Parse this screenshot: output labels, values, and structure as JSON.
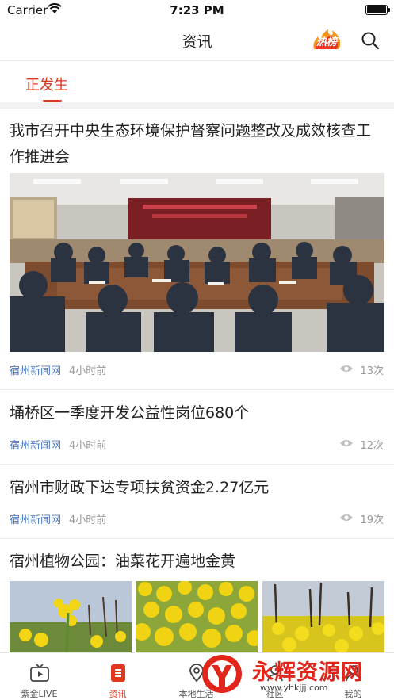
{
  "status_bar": {
    "carrier": "Carrier",
    "time": "7:23 PM"
  },
  "nav": {
    "title": "资讯",
    "hot_badge": "热榜",
    "search_icon": "search-icon"
  },
  "tabs": [
    {
      "label": "正发生",
      "active": true
    }
  ],
  "news": [
    {
      "title": "我市召开中央生态环境保护督察问题整改及成效核查工作推进会",
      "source": "宿州新闻网",
      "time": "4小时前",
      "views": "13次",
      "image": "meeting-photo"
    },
    {
      "title": "埇桥区一季度开发公益性岗位680个",
      "source": "宿州新闻网",
      "time": "4小时前",
      "views": "12次"
    },
    {
      "title": "宿州市财政下达专项扶贫资金2.27亿元",
      "source": "宿州新闻网",
      "time": "4小时前",
      "views": "19次"
    },
    {
      "title": "宿州植物公园：油菜花开遍地金黄",
      "images": [
        "rapeseed-photo-1",
        "rapeseed-photo-2",
        "rapeseed-photo-3"
      ]
    }
  ],
  "bottom_tabs": [
    {
      "label": "紫金LIVE",
      "icon": "tv-icon"
    },
    {
      "label": "资讯",
      "icon": "news-icon",
      "active": true
    },
    {
      "label": "本地生活",
      "icon": "location-icon"
    },
    {
      "label": "社区",
      "icon": "community-icon"
    },
    {
      "label": "我的",
      "icon": "user-icon"
    }
  ],
  "watermark": {
    "name": "永辉资源网",
    "url": "www.yhkjjj.com"
  },
  "colors": {
    "accent": "#e0371f",
    "source_blue": "#4a78c2",
    "meta_gray": "#999999"
  }
}
